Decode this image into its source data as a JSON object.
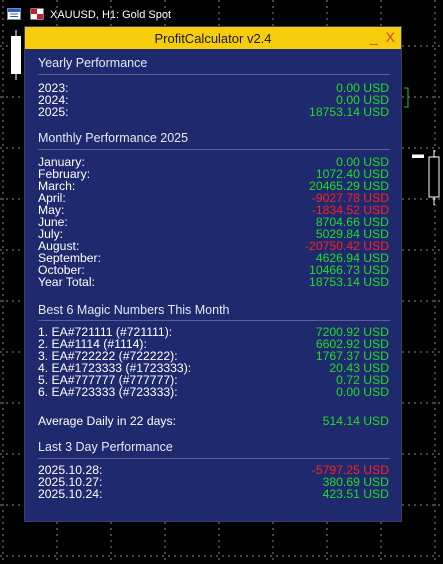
{
  "chart_window": {
    "title": "XAUUSD, H1:  Gold Spot"
  },
  "panel": {
    "title": "ProfitCalculator v2.4",
    "minimize_label": "_",
    "close_label": "X"
  },
  "yearly": {
    "title": "Yearly Performance",
    "rows": [
      {
        "label": "2023:",
        "value": "0.00 USD"
      },
      {
        "label": "2024:",
        "value": "0.00 USD"
      },
      {
        "label": "2025:",
        "value": "18753.14 USD"
      }
    ]
  },
  "monthly": {
    "title": "Monthly Performance 2025",
    "rows": [
      {
        "label": "January:",
        "value": "0.00 USD"
      },
      {
        "label": "February:",
        "value": "1072.40 USD"
      },
      {
        "label": "March:",
        "value": "20465.29 USD"
      },
      {
        "label": "April:",
        "value": "-9027.78 USD"
      },
      {
        "label": "May:",
        "value": "-1834.52 USD"
      },
      {
        "label": "June:",
        "value": "8704.66 USD"
      },
      {
        "label": "July:",
        "value": "5029.84 USD"
      },
      {
        "label": "August:",
        "value": "-20750.42 USD"
      },
      {
        "label": "September:",
        "value": "4626.94 USD"
      },
      {
        "label": "October:",
        "value": "10466.73 USD"
      },
      {
        "label": "Year Total:",
        "value": "18753.14 USD"
      }
    ]
  },
  "magic": {
    "title": "Best 6 Magic Numbers This Month",
    "rows": [
      {
        "label": "1. EA#721111 (#721111):",
        "value": "7200.92 USD"
      },
      {
        "label": "2. EA#1114 (#1114):",
        "value": "6602.92 USD"
      },
      {
        "label": "3. EA#722222 (#722222):",
        "value": "1767.37 USD"
      },
      {
        "label": "4. EA#1723333 (#1723333):",
        "value": "20.43 USD"
      },
      {
        "label": "5. EA#777777 (#777777):",
        "value": "0.72 USD"
      },
      {
        "label": "6. EA#723333 (#723333):",
        "value": "0.00 USD"
      }
    ]
  },
  "average": {
    "label": "Average Daily in 22 days:",
    "value": "514.14 USD"
  },
  "last3": {
    "title": "Last 3 Day Performance",
    "rows": [
      {
        "label": "2025.10.28:",
        "value": "-5797.25 USD"
      },
      {
        "label": "2025.10.27:",
        "value": "380.69 USD"
      },
      {
        "label": "2025.10.24:",
        "value": "423.51 USD"
      }
    ]
  },
  "colors": {
    "panel_bg": "#1f2a6e",
    "header_bg": "#f5cd0a",
    "positive": "#22dd22",
    "negative": "#ff2020",
    "close_button": "#e23c2f"
  }
}
